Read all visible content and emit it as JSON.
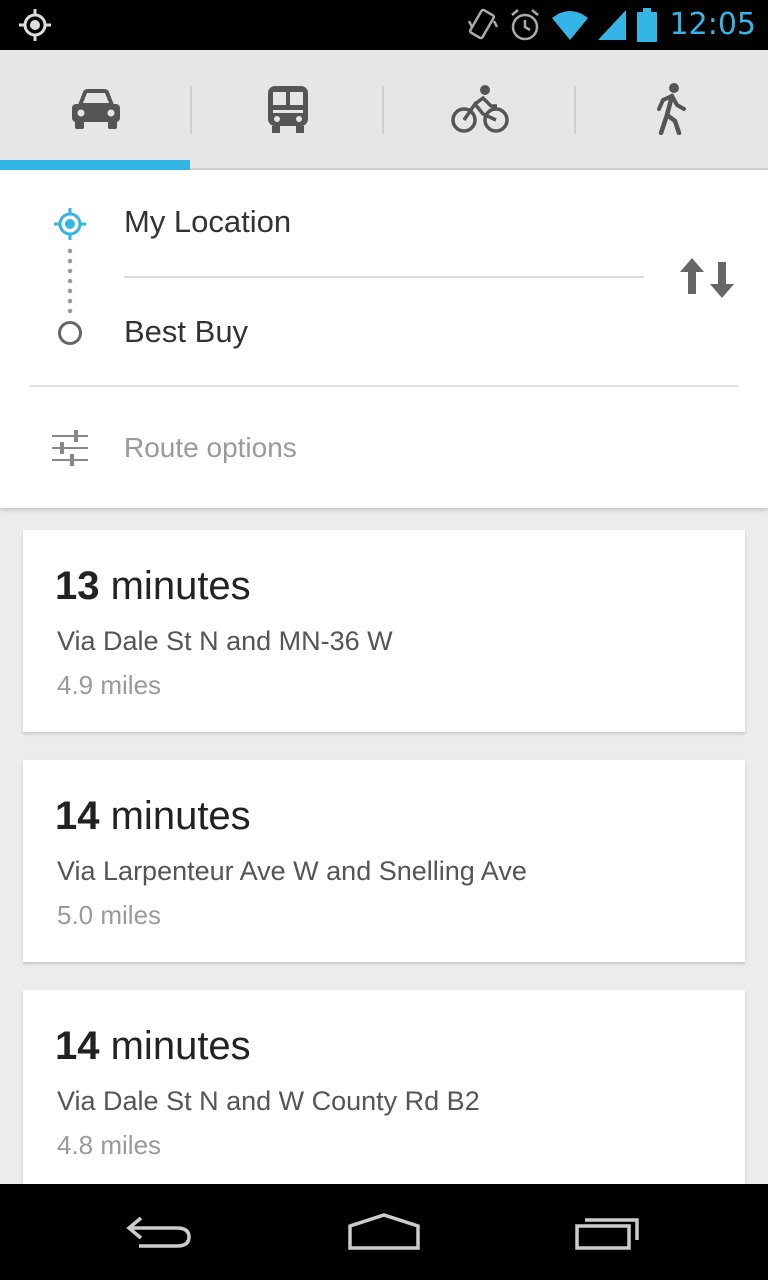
{
  "status_bar": {
    "time": "12:05",
    "icons": [
      "location-icon",
      "vibrate-icon",
      "alarm-icon",
      "wifi-icon",
      "signal-icon",
      "battery-icon"
    ]
  },
  "mode_tabs": [
    {
      "icon": "car-icon",
      "selected": true
    },
    {
      "icon": "transit-icon",
      "selected": false
    },
    {
      "icon": "bike-icon",
      "selected": false
    },
    {
      "icon": "walk-icon",
      "selected": false
    }
  ],
  "directions": {
    "from": "My Location",
    "to": "Best Buy",
    "route_options_label": "Route options"
  },
  "routes": [
    {
      "time_num": "13",
      "time_unit": " minutes",
      "via": "Via Dale St N and MN-36 W",
      "distance": "4.9 miles"
    },
    {
      "time_num": "14",
      "time_unit": " minutes",
      "via": "Via Larpenteur Ave W and Snelling Ave",
      "distance": "5.0 miles"
    },
    {
      "time_num": "14",
      "time_unit": " minutes",
      "via": "Via Dale St N and W County Rd B2",
      "distance": "4.8 miles"
    }
  ],
  "colors": {
    "accent": "#33b5e5",
    "status_bar_bg": "#000000",
    "tab_bar_bg": "#e6e6e6",
    "screen_bg": "#ececec"
  }
}
